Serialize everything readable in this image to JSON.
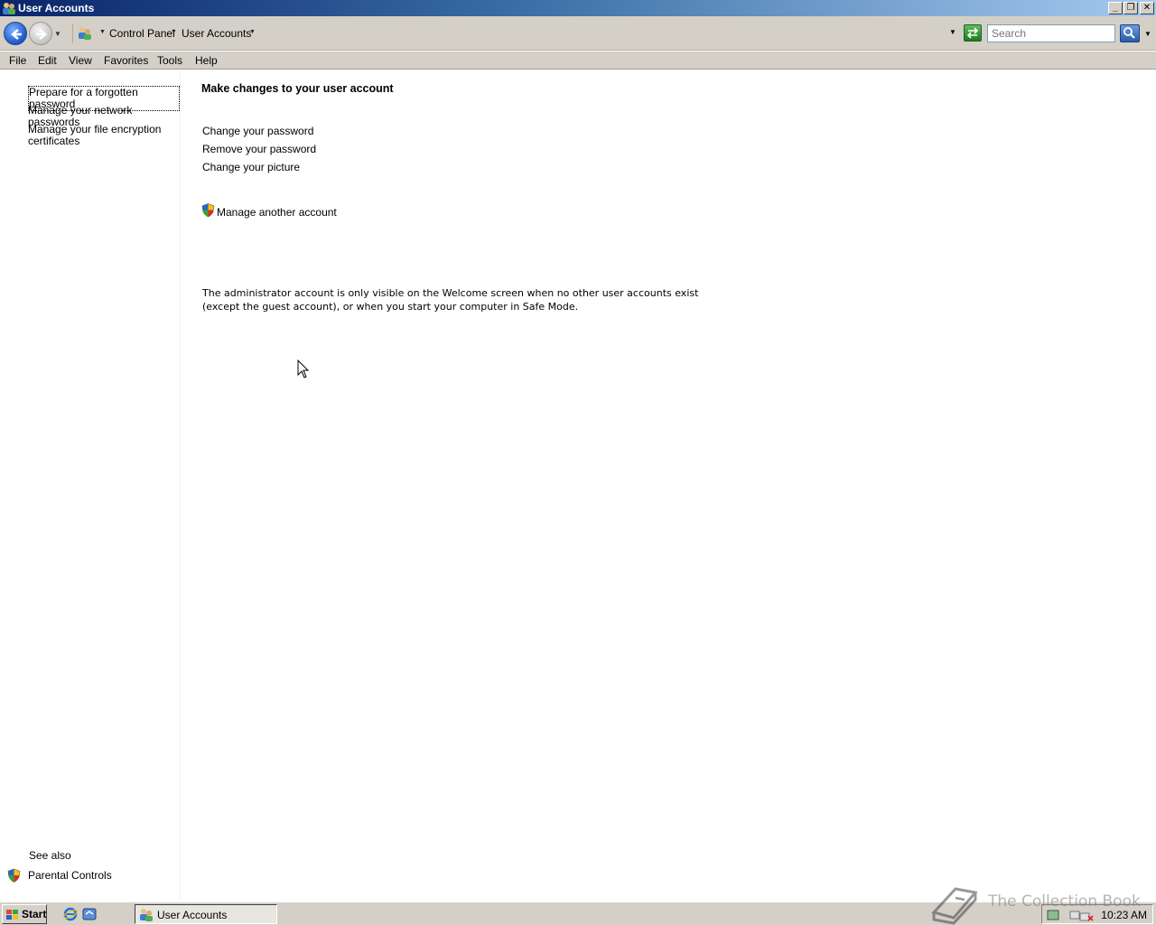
{
  "window": {
    "title": "User Accounts"
  },
  "address": {
    "crumbs": [
      "Control Panel",
      "User Accounts"
    ],
    "search_placeholder": "Search"
  },
  "menu": [
    "File",
    "Edit",
    "View",
    "Favorites",
    "Tools",
    "Help"
  ],
  "tasks": {
    "forgot_password": "Prepare for a forgotten password",
    "network_passwords": "Manage your network passwords",
    "encryption_certs": "Manage your file encryption certificates"
  },
  "see_also": {
    "heading": "See also",
    "parental_controls": "Parental Controls"
  },
  "main": {
    "title": "Make changes to your user account",
    "links": {
      "change_password": "Change your password",
      "remove_password": "Remove your password",
      "change_picture": "Change your picture",
      "manage_another": "Manage another account"
    },
    "note": "The administrator account is only visible on the Welcome screen when no other user accounts exist (except the guest account), or when you start your computer in Safe Mode."
  },
  "taskbar": {
    "start_label": "Start",
    "open_window": "User Accounts",
    "clock": "10:23 AM"
  },
  "watermark": "The Collection Book",
  "colors": {
    "titlebar_start": "#0a246a",
    "titlebar_end": "#a6caf0",
    "chrome": "#d4d0c8"
  }
}
